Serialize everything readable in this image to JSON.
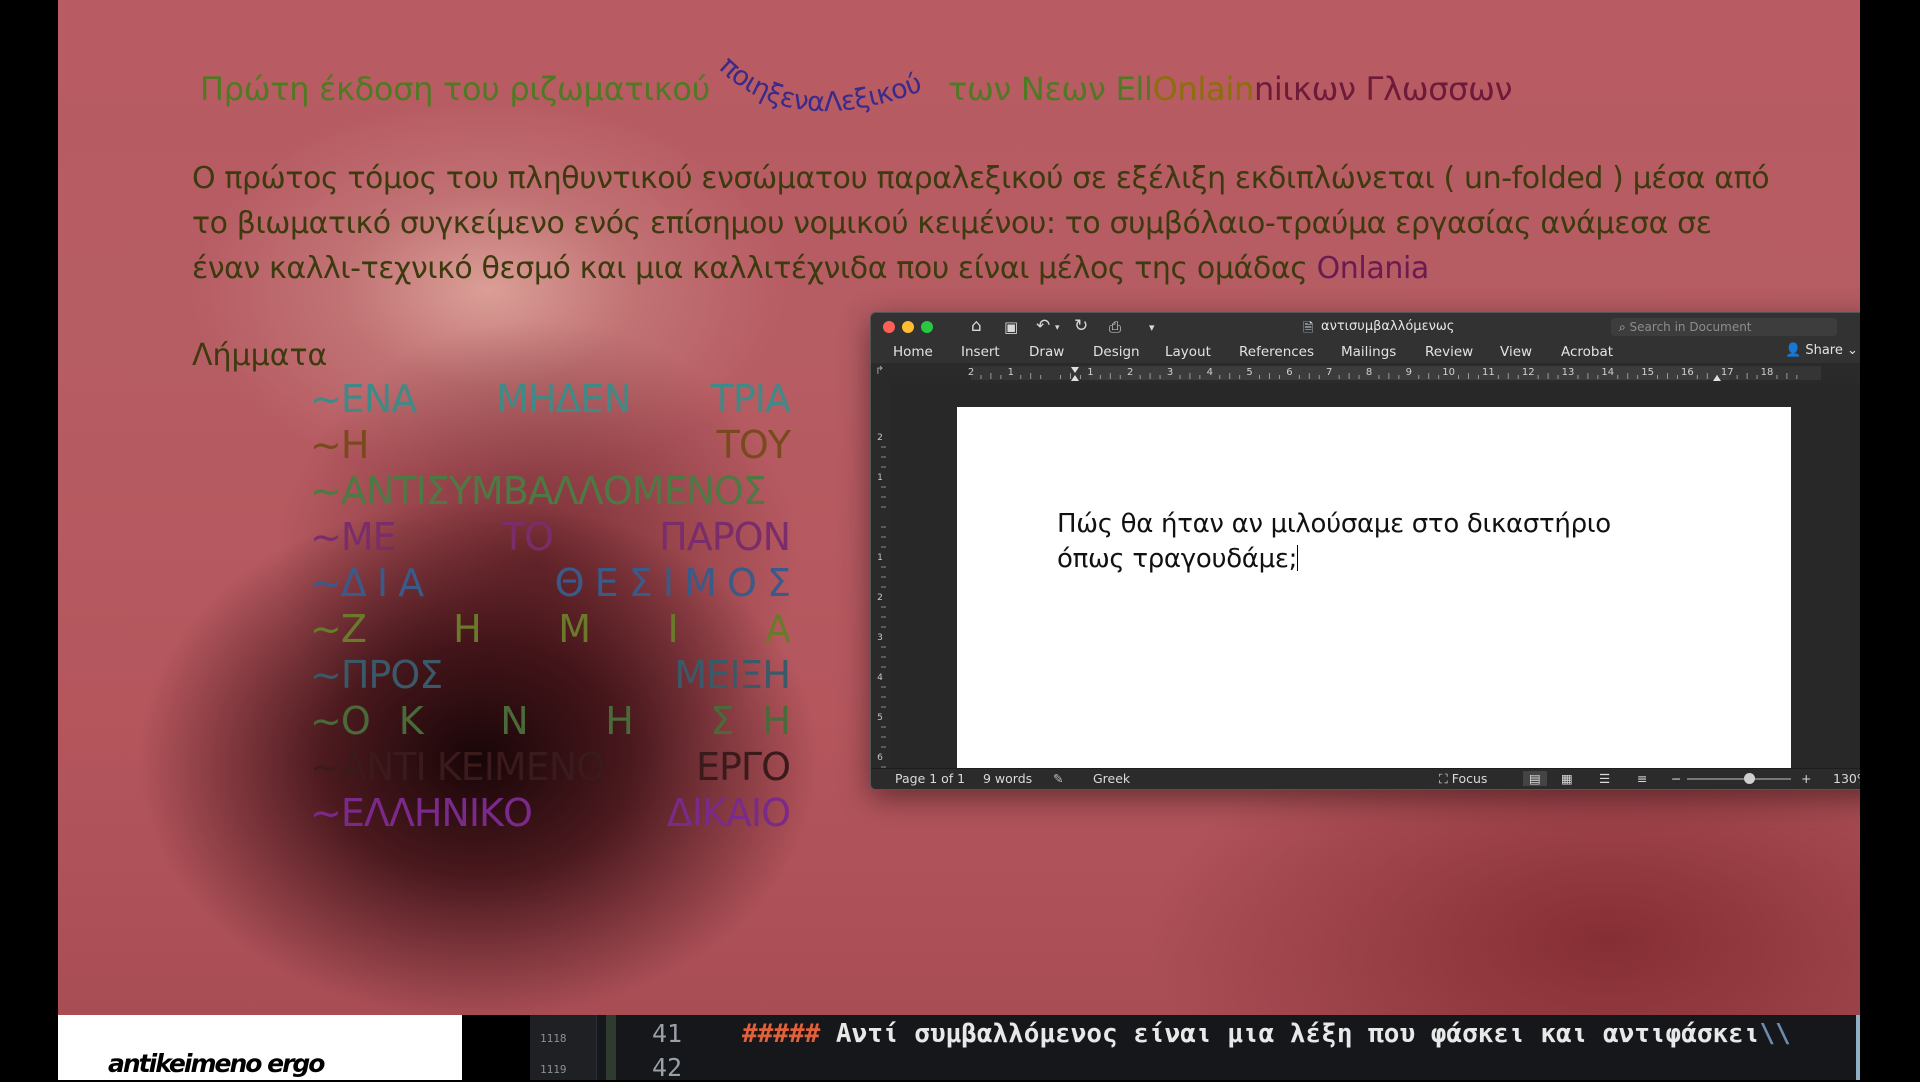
{
  "headline": {
    "left": "Πρώτη έκδοση του ριζωματικού",
    "curved": "ποιηξεναΛεξικού",
    "right_a": "των Νεων Ell",
    "right_b": "Onlain",
    "right_c": "niικων Γλωσσων"
  },
  "paragraph": {
    "text": "Ο πρώτος τόμος του πληθυντικού ενσώματου παραλεξικού σε εξέλιξη εκδιπλώνεται ( un-folded ) μέσα από το βιωματικό συγκείμενο ενός επίσημου νομικού κειμένου: το συμβόλαιο-τραύμα εργασίας ανάμεσα σε έναν καλλι-τεχνικό θεσμό και μια καλλιτέχνιδα που είναι μέλος της ομάδας ",
    "highlight": "Onlania"
  },
  "lemmas_heading": "Λήμματα",
  "lemmas": [
    {
      "a": "~ΕΝΑ",
      "b": "ΜΗΔΕΝ",
      "c": "ΤΡΙΑ"
    },
    {
      "a": "~Η",
      "b": "",
      "c": "ΤΟΥ"
    },
    {
      "a": "~ΑΝΤΙΣΥΜΒΑΛΛΟΜΕΝΟΣ",
      "b": "",
      "c": ""
    },
    {
      "a": "~ΜΕ",
      "b": "ΤΟ",
      "c": "ΠΑΡΟΝ"
    },
    {
      "a": "~Δ Ι Α",
      "b": "",
      "c": "Θ Ε Σ Ι Μ Ο Σ"
    },
    {
      "a": "~Ζ",
      "b": "Η       Μ       Ι",
      "c": "Α"
    },
    {
      "a": "~ΠΡΟΣ",
      "b": "",
      "c": "ΜΕΙΞΗ"
    },
    {
      "a": "~Ο",
      "b": "Κ       Ν       Η       Σ",
      "c": "Η"
    },
    {
      "a": "~ΑΝΤΙ ΚΕΙΜΕΝΟ",
      "b": "",
      "c": "ΕΡΓΟ"
    },
    {
      "a": "~ΕΛΛΗΝΙΚΟ",
      "b": "",
      "c": "ΔΙΚΑΙΟ"
    }
  ],
  "word": {
    "doc_title": "αντισυμβαλλόμενως",
    "search_placeholder": "Search in Document",
    "tabs": [
      "Home",
      "Insert",
      "Draw",
      "Design",
      "Layout",
      "References",
      "Mailings",
      "Review",
      "View",
      "Acrobat"
    ],
    "share": "Share",
    "ruler_numbers": [
      "2",
      "1",
      "",
      "1",
      "2",
      "3",
      "4",
      "5",
      "6",
      "7",
      "8",
      "9",
      "10",
      "11",
      "12",
      "13",
      "14",
      "15",
      "16",
      "17",
      "18"
    ],
    "vruler_numbers": [
      "2",
      "1",
      "",
      "1",
      "2",
      "3",
      "4",
      "5",
      "6"
    ],
    "body_line1": "Πώς θα ήταν αν μιλούσαμε στο δικαστήριο",
    "body_line2": "όπως τραγουδάμε;",
    "status_page": "Page 1 of 1",
    "status_words": "9 words",
    "status_lang": "Greek",
    "status_focus": "Focus",
    "zoom": "130%",
    "zoom_level": 0.6
  },
  "thumbnail": {
    "text": "antikeimeno ergo"
  },
  "editor": {
    "side_numbers": [
      "1118",
      "1119"
    ],
    "line_numbers": [
      "41",
      "42"
    ],
    "line41_hash": "#####",
    "line41_text": " Αντί συμβαλλόμενος είναι μια λέξη που φάσκει και αντιφάσκει",
    "line41_escape": "\\\\"
  },
  "colors": {
    "headline_green": "#4f7a23",
    "paragraph_text": "#3c3a0e",
    "highlight_purple": "#6b1b4f",
    "window_dark": "#2a2a2a"
  },
  "icons": [
    "home-icon",
    "save-icon",
    "undo-icon",
    "redo-icon",
    "print-icon",
    "more-icon",
    "document-icon",
    "search-icon",
    "share-icon",
    "account-icon",
    "spelling-icon",
    "focus-icon",
    "print-layout-icon",
    "web-layout-icon",
    "outline-icon",
    "draft-icon"
  ]
}
